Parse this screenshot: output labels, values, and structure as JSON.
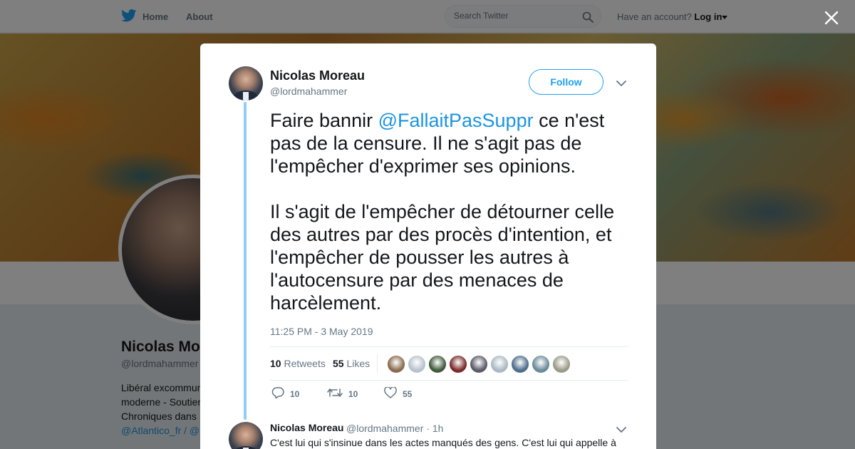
{
  "nav": {
    "home_label": "Home",
    "about_label": "About",
    "search_placeholder": "Search Twitter",
    "account_prompt": "Have an account?",
    "login_label": "Log in"
  },
  "profile_bg": {
    "name": "Nicolas Mo",
    "handle": "@lordmahammer",
    "bio_line1": "Libéral excommun",
    "bio_line2": "moderne - Soutien",
    "bio_line3": "Chroniques dans",
    "bio_link1": "@Atlantico_fr",
    "bio_sep": " / @"
  },
  "tweet": {
    "author_name": "Nicolas Moreau",
    "author_handle": "@lordmahammer",
    "follow_label": "Follow",
    "text_before": "Faire bannir ",
    "mention": "@FallaitPasSuppr",
    "text_after": " ce n'est pas de la censure. Il ne s'agit pas de l'empêcher d'exprimer ses opinions.\n\nIl s'agit de l'empêcher de détourner celle des autres par des procès d'intention, et l'empêcher de pousser les autres à l'autocensure par des menaces de harcèlement.",
    "timestamp": "11:25 PM - 3 May 2019",
    "retweets_count": "10",
    "retweets_label": "Retweets",
    "likes_count": "55",
    "likes_label": "Likes",
    "likers": [
      "#8a6a4f",
      "#b7c2cc",
      "#3f5a3a",
      "#7a2a2a",
      "#5a5a6a",
      "#aab8c4",
      "#4d6e8a",
      "#6a8a9a",
      "#9a9a8a"
    ],
    "action_reply_count": "10",
    "action_retweet_count": "10",
    "action_like_count": "55"
  },
  "reply": {
    "author_name": "Nicolas Moreau",
    "handle_time": "@lordmahammer · 1h",
    "text": "C'est lui qui s'insinue dans les actes manqués des gens. C'est lui qui appelle à"
  },
  "colors": {
    "accent": "#1da1f2",
    "link": "#1b95e0",
    "thread_line": "#8ecdf8"
  }
}
